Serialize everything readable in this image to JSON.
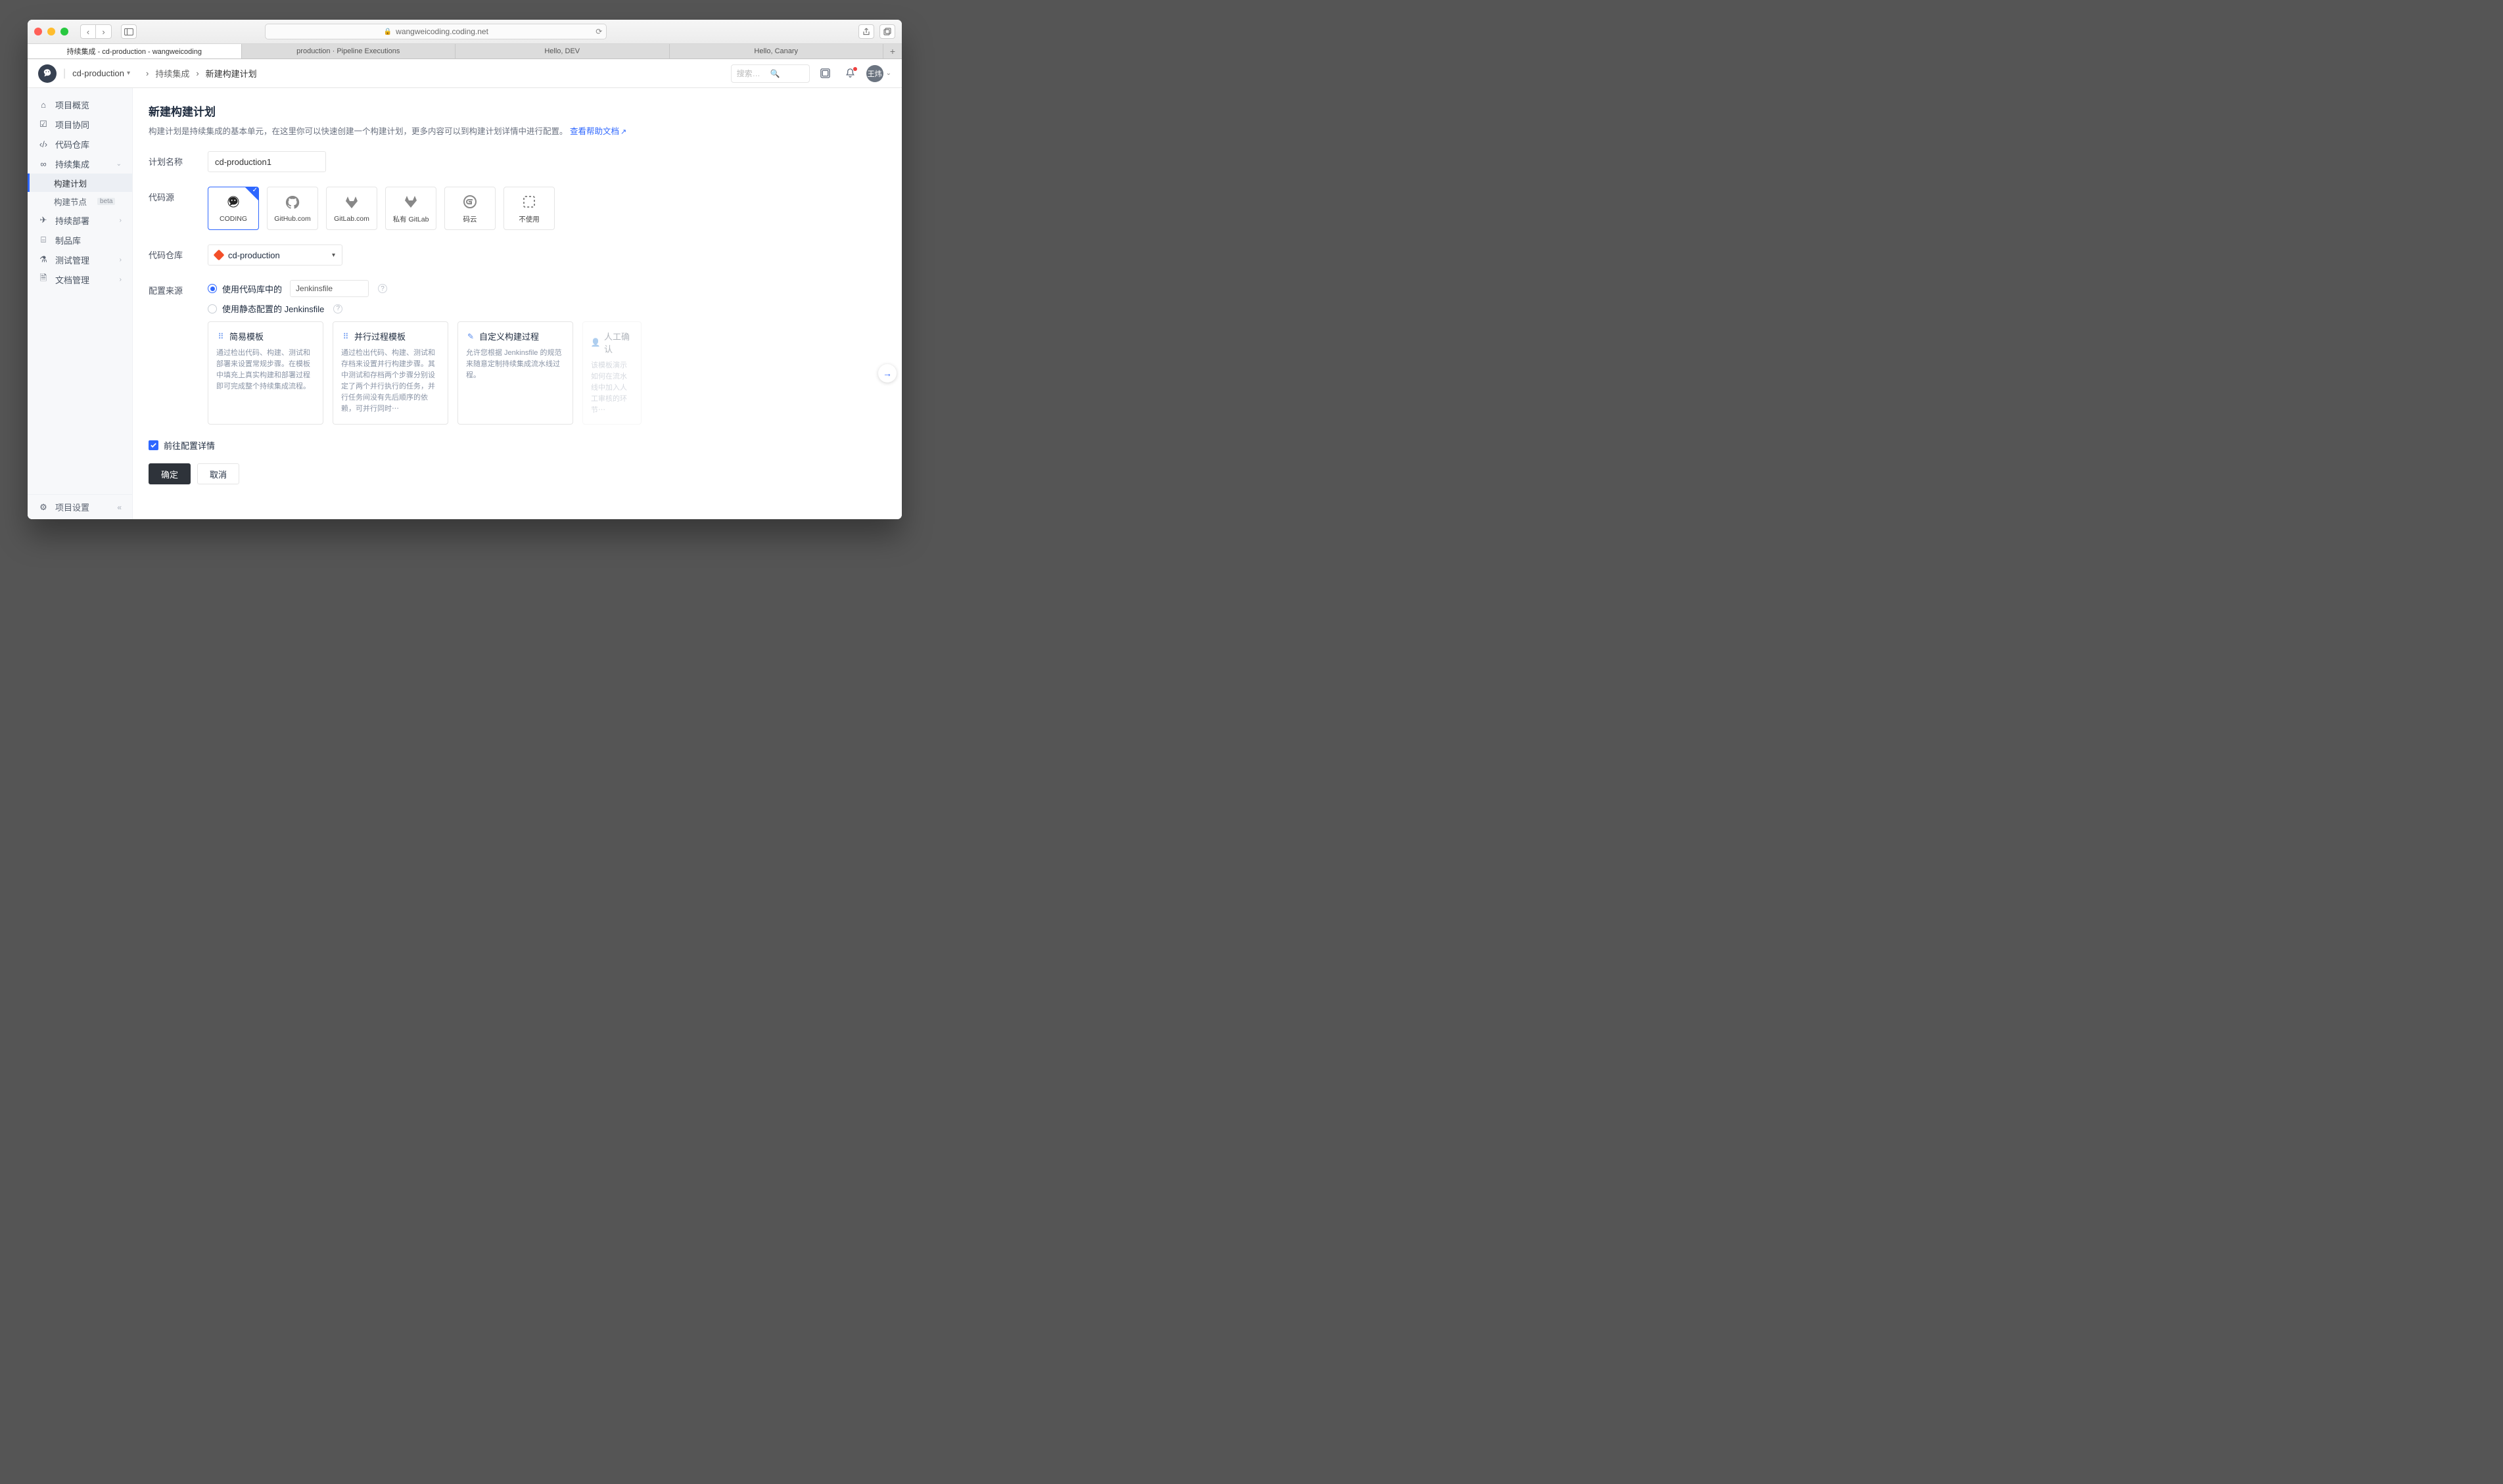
{
  "browser": {
    "url": "wangweicoding.coding.net",
    "tabs": [
      "持续集成 - cd-production - wangweicoding",
      "production · Pipeline Executions",
      "Hello, DEV",
      "Hello, Canary"
    ]
  },
  "header": {
    "project_name": "cd-production",
    "crumb_parent": "持续集成",
    "crumb_current": "新建构建计划",
    "search_placeholder": "搜索…",
    "avatar_initials": "王炜"
  },
  "sidebar": {
    "items": {
      "overview": "项目概览",
      "collab": "项目协同",
      "repo": "代码仓库",
      "ci": "持续集成",
      "ci_plan": "构建计划",
      "ci_node": "构建节点",
      "ci_node_badge": "beta",
      "cd": "持续部署",
      "artifact": "制品库",
      "test": "测试管理",
      "doc": "文档管理",
      "settings": "项目设置"
    }
  },
  "page": {
    "title": "新建构建计划",
    "desc_prefix": "构建计划是持续集成的基本单元，在这里你可以快速创建一个构建计划，更多内容可以到构建计划详情中进行配置。",
    "help_link": "查看帮助文档"
  },
  "form": {
    "plan_name_label": "计划名称",
    "plan_name_value": "cd-production1",
    "source_label": "代码源",
    "sources": {
      "coding": "CODING",
      "github": "GitHub.com",
      "gitlab": "GitLab.com",
      "private_gitlab": "私有 GitLab",
      "gitee": "码云",
      "none": "不使用"
    },
    "repo_label": "代码仓库",
    "repo_value": "cd-production",
    "config_label": "配置来源",
    "radio_from_repo": "使用代码库中的",
    "jenkinsfile_value": "Jenkinsfile",
    "radio_static": "使用静态配置的 Jenkinsfile",
    "templates": {
      "simple": {
        "title": "简易模板",
        "desc": "通过检出代码、构建、测试和部署来设置常规步骤。在模板中填充上真实构建和部署过程即可完成整个持续集成流程。"
      },
      "parallel": {
        "title": "并行过程模板",
        "desc": "通过检出代码、构建、测试和存档来设置并行构建步骤。其中测试和存档两个步骤分别设定了两个并行执行的任务，并行任务间没有先后顺序的依赖，可并行同时⋯"
      },
      "custom": {
        "title": "自定义构建过程",
        "desc": "允许您根据 Jenkinsfile 的规范来随意定制持续集成流水线过程。"
      },
      "approval": {
        "title": "人工确认",
        "desc": "该模板演示如何在流水线中加入人工审核的环节⋯"
      }
    },
    "goto_detail": "前往配置详情",
    "ok": "确定",
    "cancel": "取消"
  }
}
